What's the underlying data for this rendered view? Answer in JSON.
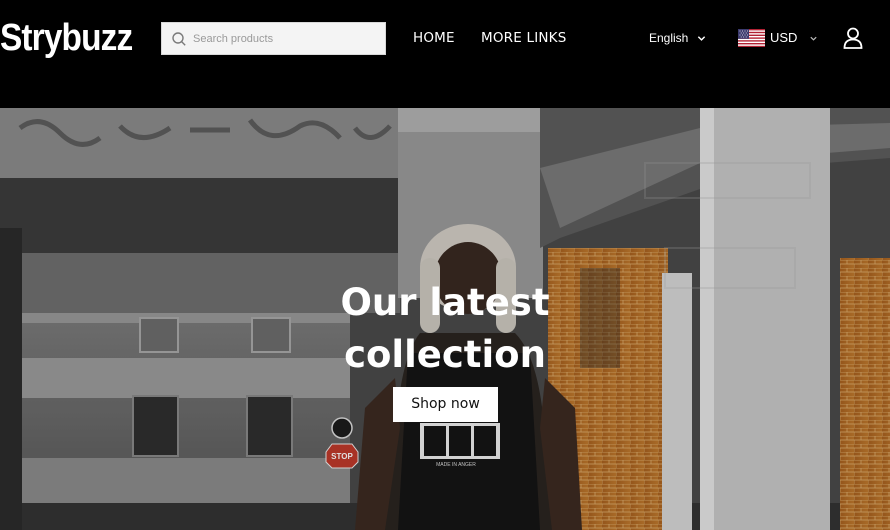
{
  "header": {
    "logo_text": "Strybuzz",
    "search_placeholder": "Search products",
    "nav": [
      {
        "label": "HOME"
      },
      {
        "label": "MORE LINKS"
      }
    ],
    "language": "English",
    "currency": "USD"
  },
  "hero": {
    "title_line1": "Our latest",
    "title_line2": "collection",
    "cta_label": "Shop now",
    "background_signs": {
      "stop_sign": "STOP",
      "shirt_text": "MADE IN ANGER"
    }
  },
  "colors": {
    "header_bg": "#000000",
    "text_white": "#ffffff",
    "search_bg": "#f4f4f4",
    "button_bg": "#ffffff",
    "brick": "#b5651d"
  },
  "icons": [
    "search-icon",
    "chevron-down-icon",
    "us-flag-icon",
    "user-icon"
  ]
}
